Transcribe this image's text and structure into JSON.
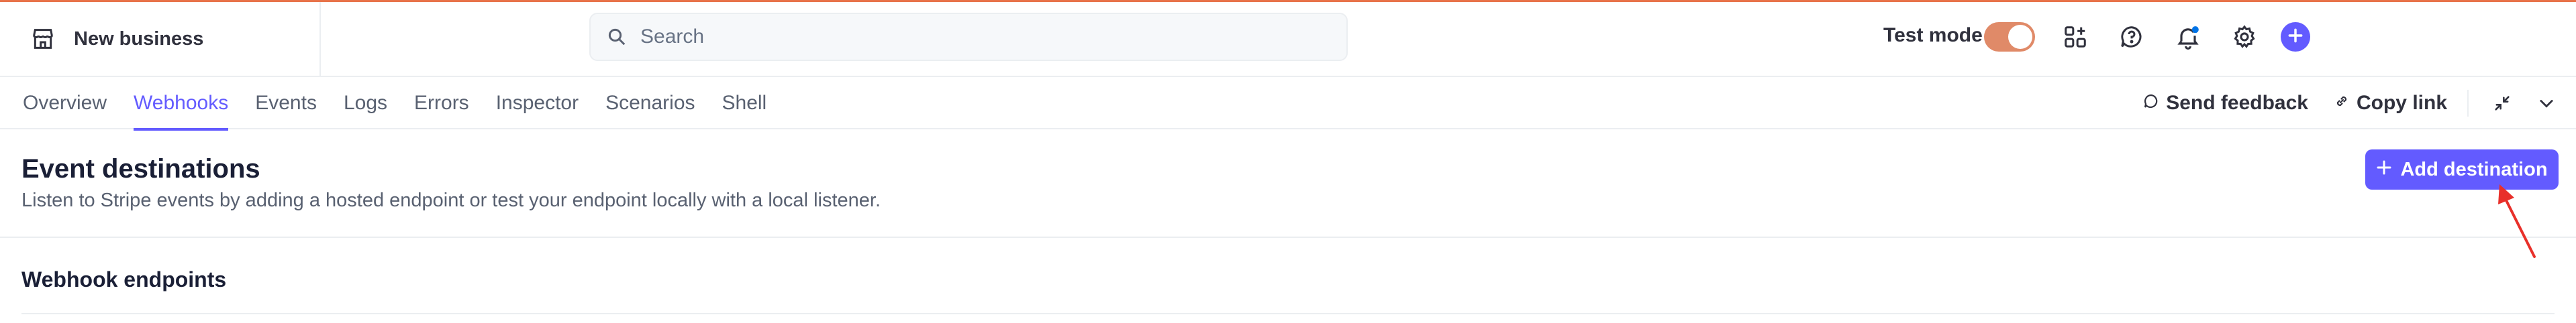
{
  "account": {
    "name": "New business",
    "icon": "store-icon"
  },
  "search": {
    "placeholder": "Search",
    "value": ""
  },
  "header_tools": {
    "test_mode_label": "Test mode",
    "test_mode_on": true,
    "icons": [
      "apps-plus-icon",
      "help-icon",
      "notification-bell-icon",
      "gear-icon",
      "plus-icon"
    ],
    "notification_dot_color": "#0073e6"
  },
  "tabs": [
    {
      "label": "Overview",
      "active": false
    },
    {
      "label": "Webhooks",
      "active": true
    },
    {
      "label": "Events",
      "active": false
    },
    {
      "label": "Logs",
      "active": false
    },
    {
      "label": "Errors",
      "active": false
    },
    {
      "label": "Inspector",
      "active": false
    },
    {
      "label": "Scenarios",
      "active": false
    },
    {
      "label": "Shell",
      "active": false
    }
  ],
  "tab_actions": {
    "feedback": "Send feedback",
    "copy_link": "Copy link"
  },
  "main": {
    "title": "Event destinations",
    "subtitle": "Listen to Stripe events by adding a hosted endpoint or test your endpoint locally with a local listener.",
    "add_button": "Add destination",
    "section_title": "Webhook endpoints"
  },
  "colors": {
    "accent": "#635bff",
    "test_mode": "#e08a68",
    "annotation_arrow": "#e8302a"
  }
}
